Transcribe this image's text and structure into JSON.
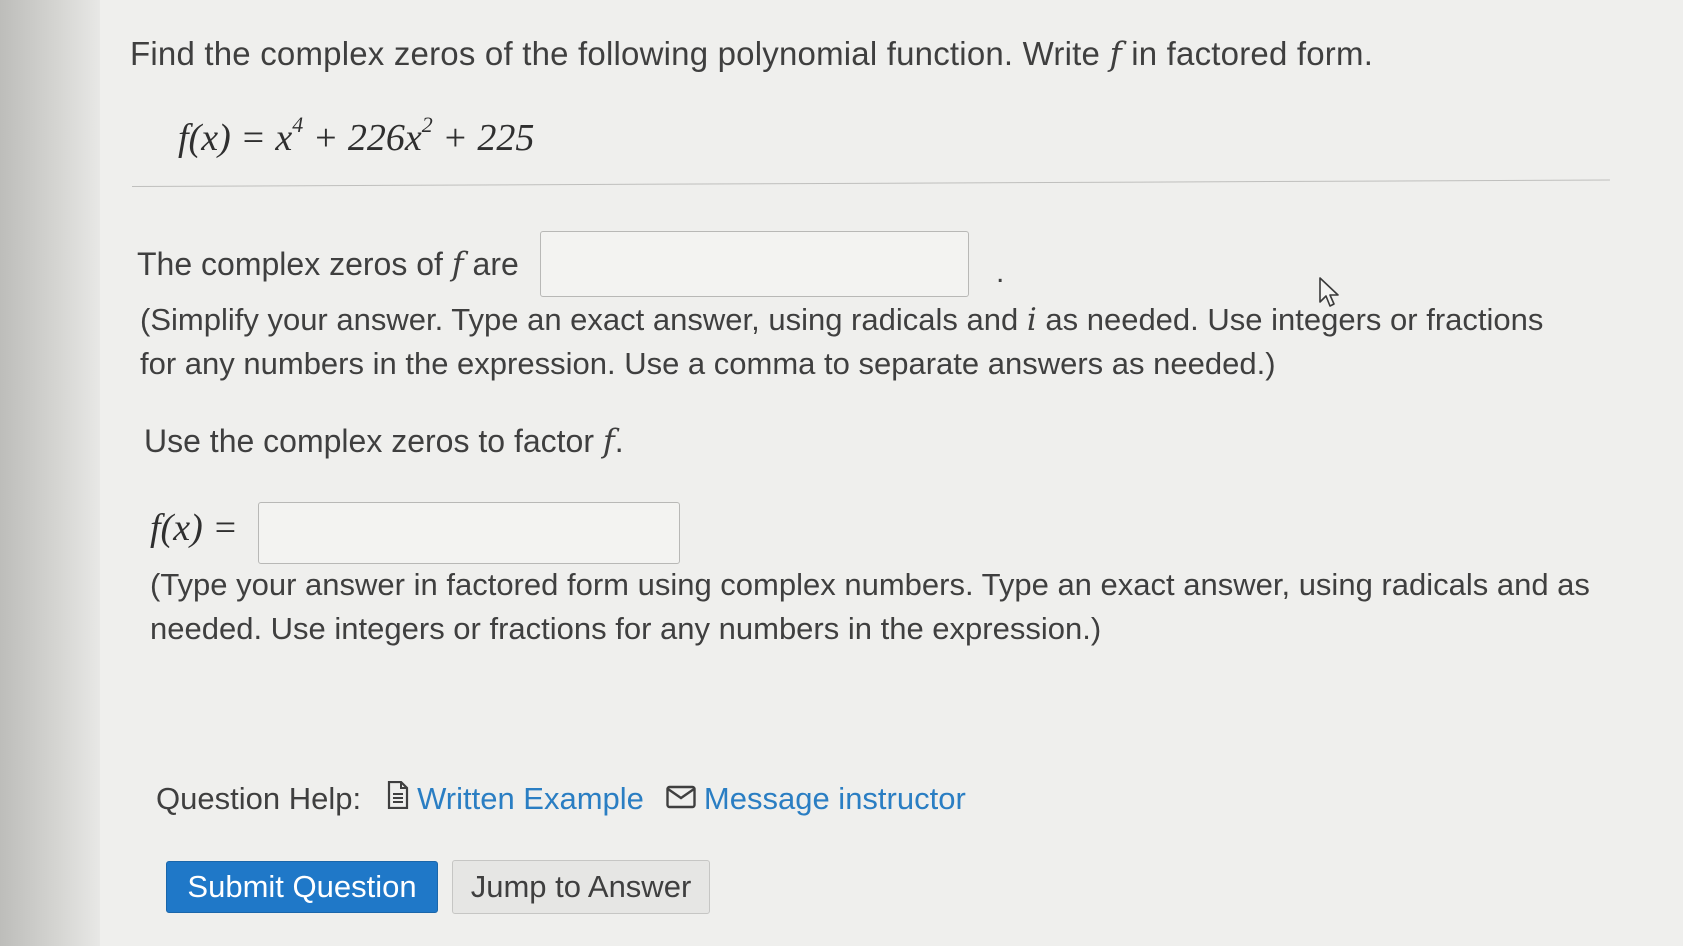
{
  "question": {
    "title_part1": "Find the complex zeros of the following polynomial function. Write ",
    "title_var": "f",
    "title_part2": " in factored form.",
    "formula": {
      "lhs": "f(x) = x",
      "exp1": "4",
      "mid": " + 226x",
      "exp2": "2",
      "tail": " + 225"
    }
  },
  "part1": {
    "prefix": "The complex zeros of ",
    "var": "f",
    "suffix": " are",
    "answer_value": "",
    "period": ".",
    "help_part1": "(Simplify your answer. Type an exact answer, using radicals and ",
    "help_var": "i",
    "help_part2": " as needed. Use integers or fractions for any numbers in the expression. Use a comma to separate answers as needed.)"
  },
  "part2": {
    "prompt_prefix": "Use the complex zeros to factor ",
    "prompt_var": "f",
    "prompt_suffix": ".",
    "fx_label": "f(x) =",
    "answer_value": "",
    "help": "(Type your answer in factored form using complex numbers. Type an exact answer, using radicals and as needed. Use integers or fractions for any numbers in the expression.)"
  },
  "question_help": {
    "label": "Question Help:",
    "written_example": "Written Example",
    "message_instructor": "Message instructor",
    "link_color": "#2a7ec3"
  },
  "buttons": {
    "submit": "Submit Question",
    "jump": "Jump to Answer",
    "submit_color": "#1f78c8"
  },
  "icons": {
    "written_example": "document-icon",
    "message_instructor": "envelope-icon",
    "cursor": "mouse-pointer-icon"
  }
}
